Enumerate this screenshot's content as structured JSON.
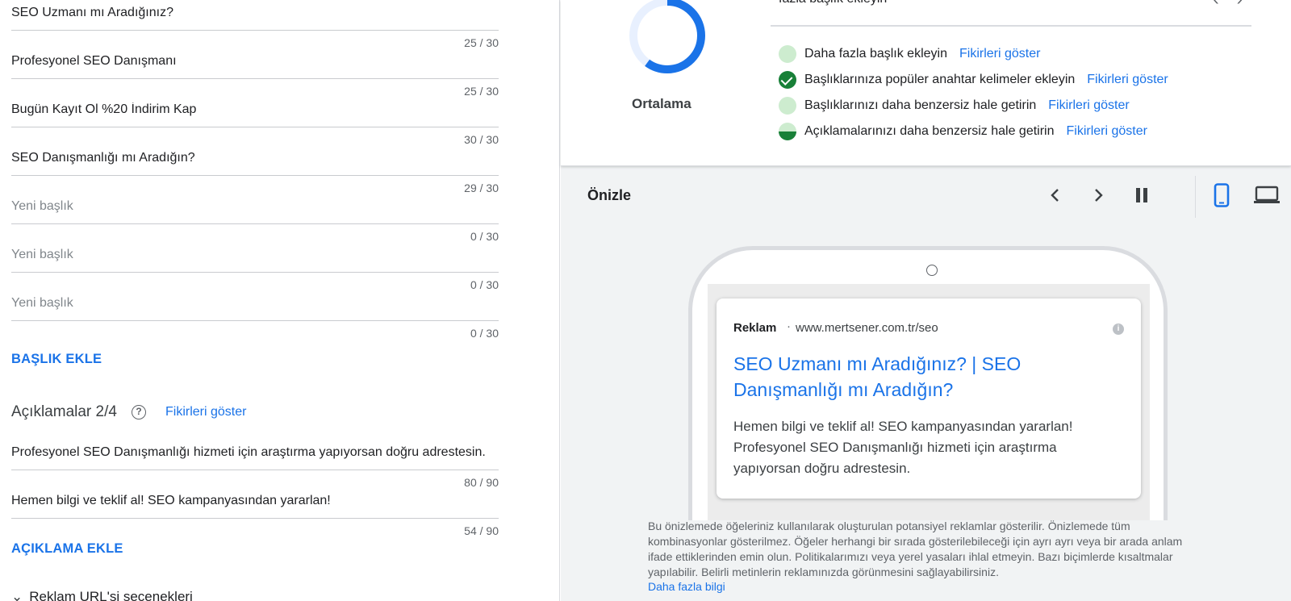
{
  "headlines": [
    {
      "value": "SEO Uzmanı mı Aradığınız?",
      "count": "25 / 30",
      "placeholder": false
    },
    {
      "value": "Profesyonel SEO Danışmanı",
      "count": "25 / 30",
      "placeholder": false
    },
    {
      "value": "Bugün Kayıt Ol %20 İndirim Kap",
      "count": "30 / 30",
      "placeholder": false
    },
    {
      "value": "SEO Danışmanlığı mı Aradığın?",
      "count": "29 / 30",
      "placeholder": false
    },
    {
      "value": "Yeni başlık",
      "count": "0 / 30",
      "placeholder": true
    },
    {
      "value": "Yeni başlık",
      "count": "0 / 30",
      "placeholder": true
    },
    {
      "value": "Yeni başlık",
      "count": "0 / 30",
      "placeholder": true
    }
  ],
  "add_headline_label": "BAŞLIK EKLE",
  "descriptions_section": {
    "title": "Açıklamalar 2/4",
    "help_icon": "?",
    "ideas_link": "Fikirleri göster",
    "items": [
      {
        "value": "Profesyonel SEO Danışmanlığı hizmeti için araştırma yapıyorsan doğru adrestesin.",
        "count": "80 / 90"
      },
      {
        "value": "Hemen bilgi ve teklif al! SEO kampanyasından yararlan!",
        "count": "54 / 90"
      }
    ],
    "add_label": "AÇIKLAMA EKLE"
  },
  "url_options": {
    "chevron": "⌄",
    "label": "Reklam URL'si seçenekleri"
  },
  "ad_strength": {
    "label": "Ortalama",
    "progress": 0.6,
    "colors": {
      "progress": "#1a73e8",
      "track": "#e8f0fe"
    },
    "top_partial_text": "fazla başlık ekleyin",
    "tips": [
      {
        "status": "empty",
        "text": "Daha fazla başlık ekleyin",
        "link": "Fikirleri göster"
      },
      {
        "status": "done",
        "text": "Başlıklarınıza popüler anahtar kelimeler ekleyin",
        "link": "Fikirleri göster"
      },
      {
        "status": "empty",
        "text": "Başlıklarınızı daha benzersiz hale getirin",
        "link": "Fikirleri göster"
      },
      {
        "status": "half",
        "text": "Açıklamalarınızı daha benzersiz hale getirin",
        "link": "Fikirleri göster"
      }
    ]
  },
  "preview": {
    "title": "Önizle",
    "controls": [
      "chevron-left-icon",
      "chevron-right-icon",
      "pause-icon",
      "mobile-icon",
      "desktop-icon"
    ],
    "ad": {
      "label": "Reklam",
      "separator": "·",
      "url": "www.mertsener.com.tr/seo",
      "info_icon": "i",
      "headline": "SEO Uzmanı mı Aradığınız? | SEO Danışmanlığı mı Aradığın?",
      "description": "Hemen bilgi ve teklif al! SEO kampanyasından yararlan! Profesyonel SEO Danışmanlığı hizmeti için araştırma yapıyorsan doğru adrestesin."
    },
    "disclaimer": "Bu önizlemede öğeleriniz kullanılarak oluşturulan potansiyel reklamlar gösterilir. Önizlemede tüm kombinasyonlar gösterilmez. Öğeler herhangi bir sırada gösterilebileceği için ayrı ayrı veya bir arada anlam ifade ettiklerinden emin olun. Politikalarımızı veya yerel yasaları ihlal etmeyin. Bazı biçimlerde kısaltmalar yapılabilir. Belirli metinlerin reklamınızda görünmesini sağlayabilirsiniz.",
    "learn_more": "Daha fazla bilgi"
  }
}
